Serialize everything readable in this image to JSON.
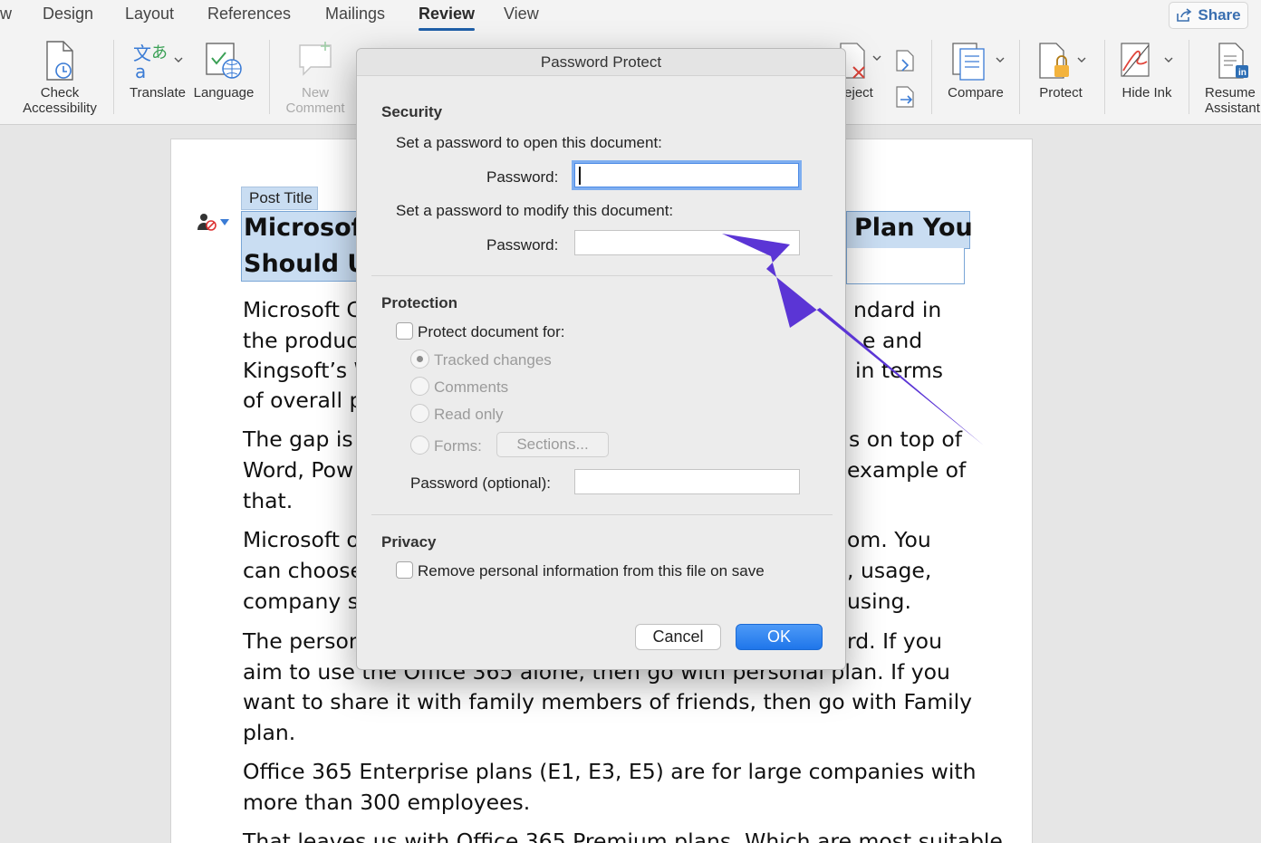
{
  "tabs": [
    {
      "label": "w"
    },
    {
      "label": "Design"
    },
    {
      "label": "Layout"
    },
    {
      "label": "References"
    },
    {
      "label": "Mailings"
    },
    {
      "label": "Review"
    },
    {
      "label": "View"
    }
  ],
  "active_tab": "Review",
  "share_label": "Share",
  "ribbon": {
    "check_accessibility": [
      "Check",
      "Accessibility"
    ],
    "translate": "Translate",
    "language": "Language",
    "new_comment": [
      "New",
      "Comment"
    ],
    "reject": "eject",
    "compare": "Compare",
    "protect": "Protect",
    "hide_ink": "Hide Ink",
    "resume_assistant": [
      "Resume",
      "Assistant"
    ]
  },
  "document": {
    "post_title_tag": "Post Title",
    "title_left": [
      "Microsoft",
      "Should Us"
    ],
    "title_right": "Plan You",
    "paragraphs_left": [
      "Microsoft C",
      "the product",
      "Kingsoft’s W",
      "of overall p",
      "The gap is c",
      "Word, Pow",
      "that.",
      "Microsoft o",
      "can choose",
      "company si",
      "The person"
    ],
    "paragraphs_right": [
      "ndard in",
      "e and",
      "in terms",
      "s on top of",
      "example of",
      "om. You",
      ", usage,",
      "using.",
      "rd. If you"
    ],
    "full_lines": [
      "aim to use the Office 365 alone, then go with personal plan. If you",
      "want to share it with family members of friends, then go with Family",
      "plan.",
      "Office 365 Enterprise plans (E1, E3, E5) are for large companies with",
      "more than 300 employees.",
      "That leaves us with Office 365 Premium plans. Which are most suitable"
    ]
  },
  "dialog": {
    "title": "Password Protect",
    "security_heading": "Security",
    "open_prompt": "Set a password to open this document:",
    "open_password_label": "Password:",
    "open_password_value": "",
    "modify_prompt": "Set a password to modify this document:",
    "modify_password_label": "Password:",
    "modify_password_value": "",
    "protection_heading": "Protection",
    "protect_for_label": "Protect document for:",
    "protect_for_checked": false,
    "options": [
      "Tracked changes",
      "Comments",
      "Read only",
      "Forms:"
    ],
    "selected_option": "Tracked changes",
    "sections_button": "Sections...",
    "optional_password_label": "Password (optional):",
    "privacy_heading": "Privacy",
    "remove_info_label": "Remove personal information from this file on save",
    "remove_info_checked": false,
    "cancel_label": "Cancel",
    "ok_label": "OK"
  },
  "colors": {
    "accent": "#1f76ea",
    "annotation_arrow": "#5b35d5",
    "title_highlight": "#c9ddf2"
  }
}
